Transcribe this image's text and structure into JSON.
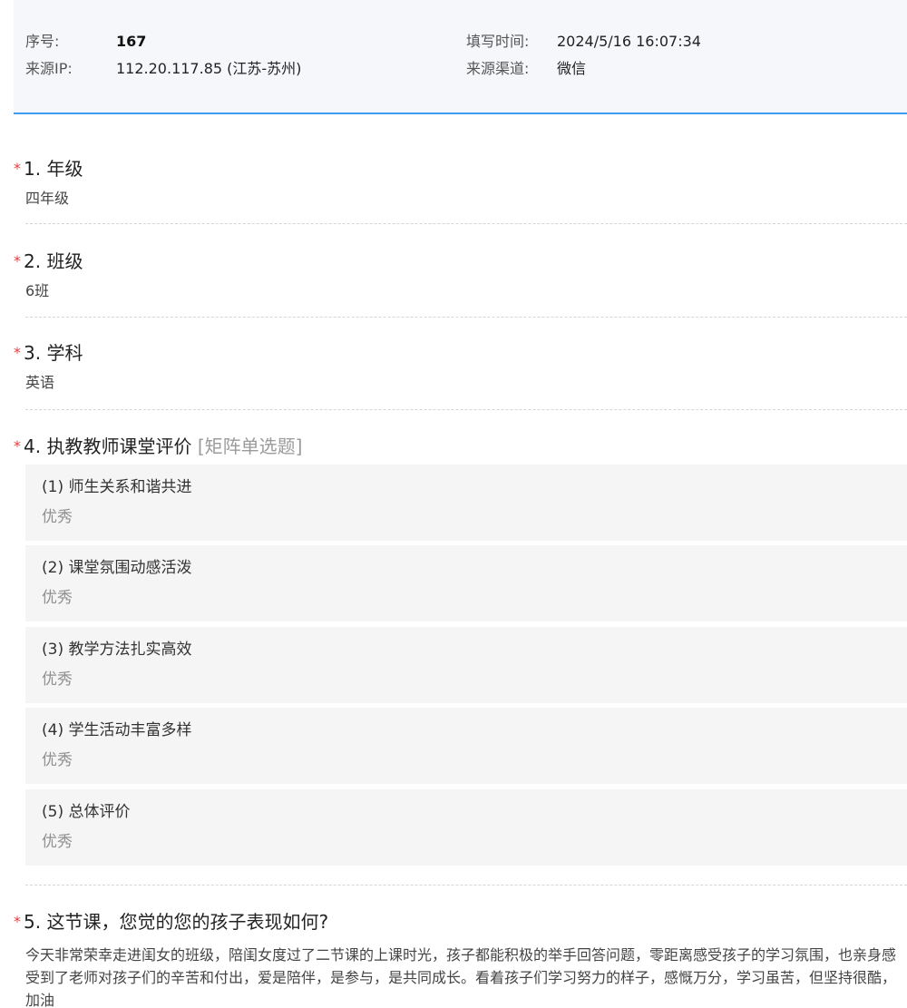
{
  "info": {
    "seq_label": "序号:",
    "seq_value": "167",
    "ip_label": "来源IP:",
    "ip_value": "112.20.117.85  (江苏-苏州)",
    "time_label": "填写时间:",
    "time_value": "2024/5/16 16:07:34",
    "channel_label": "来源渠道:",
    "channel_value": "微信"
  },
  "questions": {
    "q1": {
      "star": "*",
      "title": "1. 年级",
      "answer": "四年级"
    },
    "q2": {
      "star": "*",
      "title": "2. 班级",
      "answer": "6班"
    },
    "q3": {
      "star": "*",
      "title": "3. 学科",
      "answer": "英语"
    },
    "q4": {
      "star": "*",
      "title": "4. 执教教师课堂评价",
      "type": "[矩阵单选题]",
      "rows": [
        {
          "label": "(1) 师生关系和谐共进",
          "value": "优秀"
        },
        {
          "label": "(2) 课堂氛围动感活泼",
          "value": "优秀"
        },
        {
          "label": "(3) 教学方法扎实高效",
          "value": "优秀"
        },
        {
          "label": "(4) 学生活动丰富多样",
          "value": "优秀"
        },
        {
          "label": "(5) 总体评价",
          "value": "优秀"
        }
      ]
    },
    "q5": {
      "star": "*",
      "title": "5. 这节课，您觉的您的孩子表现如何?",
      "answer": "今天非常荣幸走进闺女的班级，陪闺女度过了二节课的上课时光，孩子都能积极的举手回答问题，零距离感受孩子的学习氛围，也亲身感受到了老师对孩子们的辛苦和付出，爱是陪伴，是参与，是共同成长。看着孩子们学习努力的样子，感慨万分，学习虽苦，但坚持很酷，加油"
    }
  },
  "colors": {
    "accent": "#3f9cf0",
    "required_star": "#e83b3b",
    "panel_bg": "#f5f7fa",
    "matrix_bg": "#f5f5f5"
  }
}
